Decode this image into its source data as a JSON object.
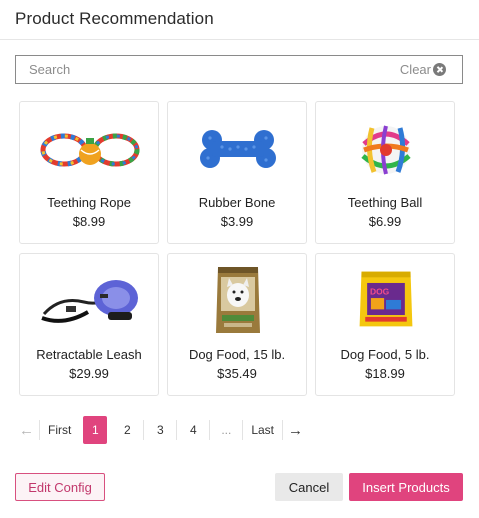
{
  "dialog": {
    "title": "Product Recommendation"
  },
  "search": {
    "placeholder": "Search",
    "value": "",
    "clear_label": "Clear"
  },
  "products": [
    {
      "name": "Teething Rope",
      "price": "$8.99"
    },
    {
      "name": "Rubber Bone",
      "price": "$3.99"
    },
    {
      "name": "Teething Ball",
      "price": "$6.99"
    },
    {
      "name": "Retractable Leash",
      "price": "$29.99"
    },
    {
      "name": "Dog Food, 15 lb.",
      "price": "$35.49"
    },
    {
      "name": "Dog Food, 5 lb.",
      "price": "$18.99"
    }
  ],
  "pagination": {
    "first": "First",
    "pages": [
      "1",
      "2",
      "3",
      "4"
    ],
    "ellipsis": "...",
    "last": "Last",
    "current_page": 1
  },
  "footer": {
    "edit_config_label": "Edit Config",
    "cancel_label": "Cancel",
    "insert_label": "Insert Products"
  },
  "colors": {
    "accent": "#e0447e",
    "edit_border": "#d8507f",
    "cancel_bg": "#e9e9e9"
  }
}
